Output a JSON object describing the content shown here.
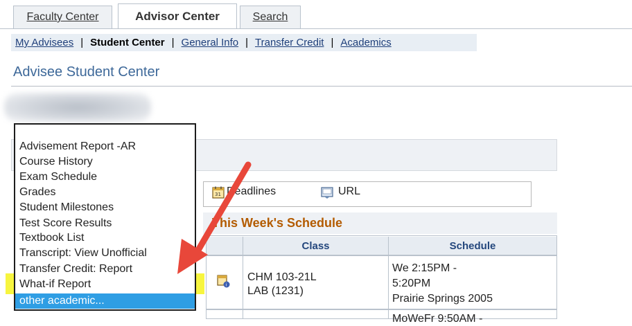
{
  "tabs": [
    "Faculty Center",
    "Advisor Center",
    "Search"
  ],
  "subnav": [
    "My Advisees",
    "Student Center",
    "General Info",
    "Transfer Credit",
    "Academics"
  ],
  "page_title": "Advisee Student Center",
  "links": {
    "deadlines": "Deadlines",
    "url": "URL"
  },
  "schedule": {
    "title": "This Week's Schedule",
    "col_class": "Class",
    "col_schedule": "Schedule",
    "rows": [
      {
        "class_line1": "CHM 103-21L",
        "class_line2": "LAB (1231)",
        "sched_line1": "We 2:15PM -",
        "sched_line2": "5:20PM",
        "sched_line3": "Prairie Springs 2005"
      },
      {
        "class_line1": "",
        "class_line2": "",
        "sched_line1": "MoWeFr 9:50AM -",
        "sched_line2": "",
        "sched_line3": ""
      }
    ]
  },
  "menu": {
    "items": [
      "Advisement Report -AR",
      "Course History",
      "Exam Schedule",
      "Grades",
      "Student Milestones",
      "Test Score Results",
      "Textbook List",
      "Transcript: View Unofficial",
      "Transfer Credit: Report",
      "What-if Report",
      "other academic..."
    ]
  },
  "colors": {
    "highlight": "#f7f53f",
    "selected": "#2f9ee4",
    "arrow": "#e8473a",
    "link": "#1f3f7a",
    "title": "#3d6899"
  }
}
